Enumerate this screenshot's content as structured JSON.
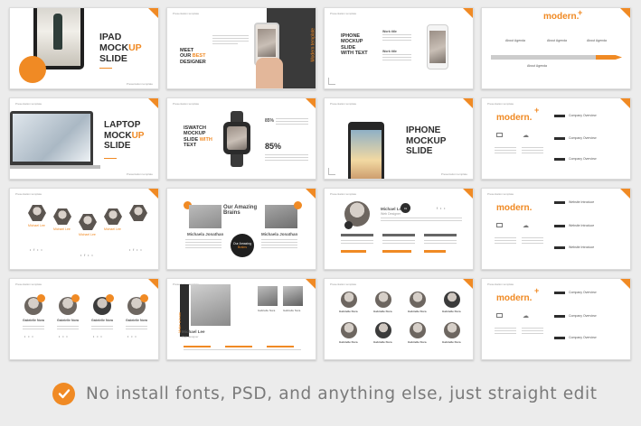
{
  "slides": {
    "s1": {
      "title_a": "IPAD",
      "title_b": "MOCK",
      "title_c": "UP",
      "title_d": "SLIDE",
      "footer": "Presentation template"
    },
    "s2": {
      "header": "Presentation template",
      "meet": "MEET",
      "our": "OUR",
      "best": "BEST",
      "designer": "DESIGNER",
      "vertical": "Modern template"
    },
    "s3": {
      "header": "Presentation template",
      "title": "IPHONE MOCKUP SLIDE WITH TEXT",
      "h1": "Work title",
      "h2": "Work title"
    },
    "s4": {
      "modern": "modern.",
      "plus": "+",
      "labels": [
        "About Agenda",
        "About Agenda",
        "About Agenda",
        "About Agenda"
      ]
    },
    "s5": {
      "header": "Presentation template",
      "title_a": "LAPTOP",
      "title_b": "MOCK",
      "title_c": "UP",
      "title_d": "SLIDE",
      "footer": "Presentation template"
    },
    "s6": {
      "header": "Presentation template",
      "title_a": "ISWATCH",
      "title_b": "MOCKUP",
      "title_c": "SLIDE",
      "title_d": "WITH",
      "title_e": "TEXT",
      "pct1": "85%",
      "pct2": "85%"
    },
    "s7": {
      "header": "Presentation template",
      "title_a": "IPHONE",
      "title_b": "MOCKUP",
      "title_c": "SLIDE",
      "footer": "Presentation template"
    },
    "s8": {
      "header": "Presentation template",
      "modern": "modern.",
      "plus": "+",
      "labels": [
        "Company Overview",
        "Company Overview",
        "Company Overview"
      ]
    },
    "s9": {
      "header": "Presentation template",
      "names": [
        "Michael Lee",
        "Michael Lee",
        "Michael Lee",
        "Michael Lee"
      ],
      "role": "Manager",
      "social": "• f • •"
    },
    "s10": {
      "heading_a": "Our Amazing",
      "heading_b": "Brains",
      "name1": "Michaela Jonathan",
      "name2": "Michaela Jonathan",
      "center_a": "Our Amazing",
      "center_b": "Brains"
    },
    "s11": {
      "header": "Presentation template",
      "name": "Michael Lee",
      "role": "Web Designer",
      "social": "f • •",
      "num": "01"
    },
    "s12": {
      "header": "Presentation template",
      "modern": "modern.",
      "labels": [
        "Website Introduce",
        "Website Introduce",
        "Website Introduce"
      ]
    },
    "s13": {
      "header": "Presentation template",
      "name": "Gabrielle Nora",
      "role": "Manager",
      "social": "• • •"
    },
    "s14": {
      "header": "Presentation template",
      "vertical": "Make a team",
      "name": "Michael Lee",
      "role": "Web designer",
      "member": "Gabrielle Nora"
    },
    "s15": {
      "header": "Presentation template",
      "name": "Gabrielle Nora",
      "role": "Manager"
    },
    "s16": {
      "header": "Presentation template",
      "modern": "modern.",
      "plus": "+",
      "labels": [
        "Company Overview",
        "Company Overview",
        "Company Overview"
      ]
    }
  },
  "caption": "No install fonts, PSD, and anything else, just straight edit",
  "colors": {
    "accent": "#f08a24",
    "dark": "#2d2d2d",
    "background": "#ececec"
  }
}
